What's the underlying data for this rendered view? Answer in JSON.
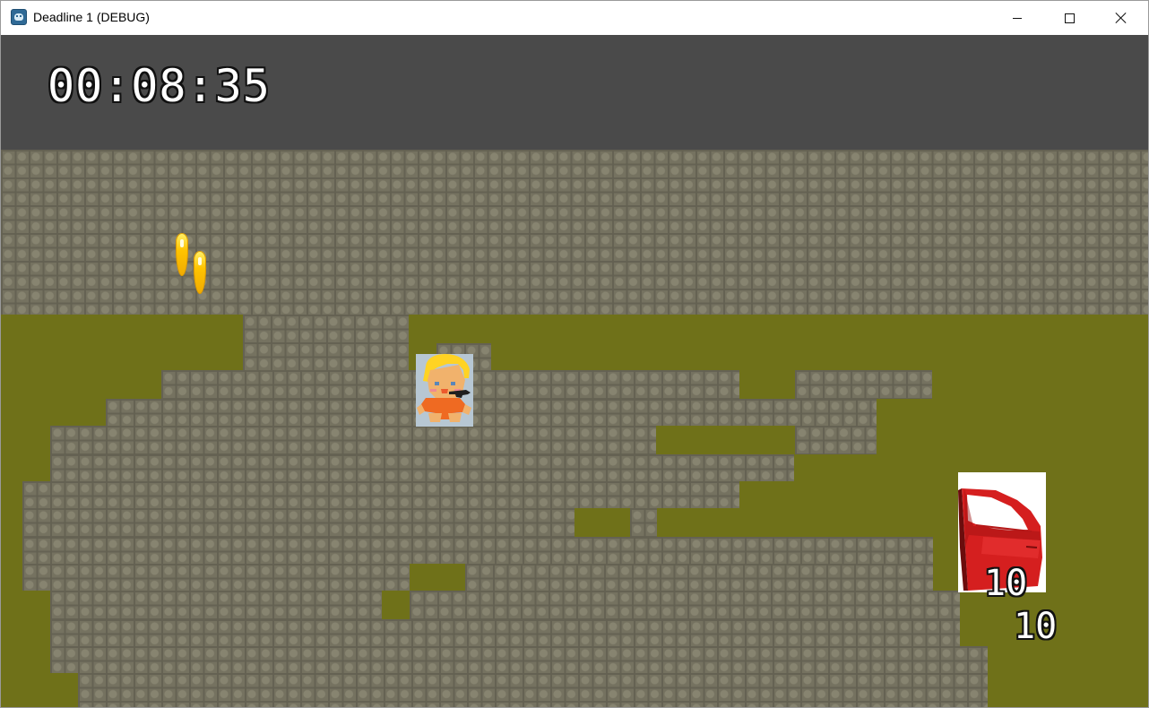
{
  "window": {
    "title": "Deadline 1 (DEBUG)",
    "controls": {
      "minimize_icon": "minimize-icon",
      "maximize_icon": "maximize-icon",
      "close_icon": "close-icon"
    }
  },
  "hud": {
    "timer": "00:08:35"
  },
  "game": {
    "counter_primary": "10",
    "counter_secondary": "10",
    "sprites": {
      "pins": "yellow-marker-pins",
      "player": "blonde-character-with-gun",
      "door": "red-car-door"
    }
  },
  "colors": {
    "hud_background": "#4a4a4a",
    "grass": "#6f7119",
    "stone": "#85826f",
    "marker": "#ffc400"
  }
}
